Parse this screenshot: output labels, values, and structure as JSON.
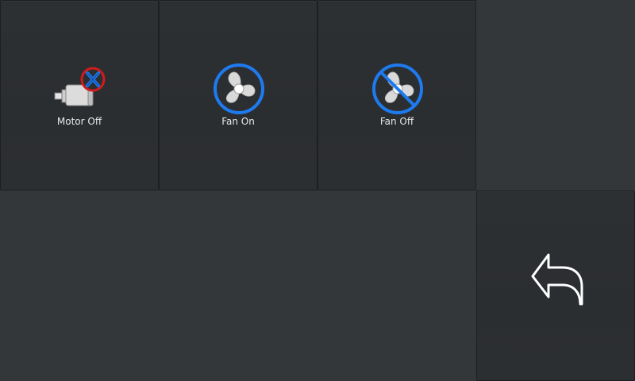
{
  "buttons": {
    "motor_off": {
      "label": "Motor Off",
      "icon": "motor-off-icon"
    },
    "fan_on": {
      "label": "Fan On",
      "icon": "fan-on-icon"
    },
    "fan_off": {
      "label": "Fan Off",
      "icon": "fan-off-icon"
    },
    "back": {
      "icon": "back-arrow-icon"
    }
  },
  "colors": {
    "background": "#33373a",
    "tile": "#2c2f32",
    "accent_blue": "#1e7bef",
    "alert_red": "#d01c1c",
    "icon_gray": "#d9d9d9",
    "text": "#e8e8e8"
  }
}
